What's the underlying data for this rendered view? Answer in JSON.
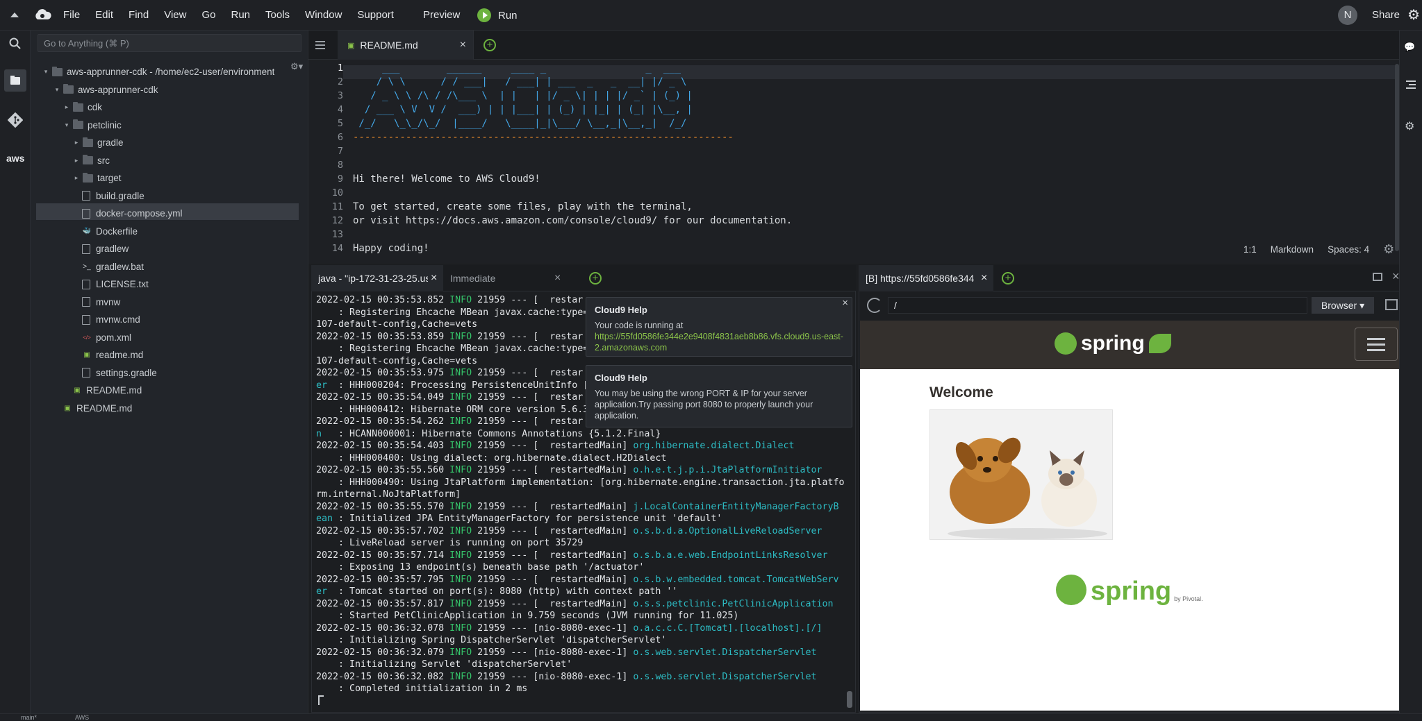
{
  "menubar": {
    "items": [
      "File",
      "Edit",
      "Find",
      "View",
      "Go",
      "Run",
      "Tools",
      "Window",
      "Support"
    ],
    "preview_label": "Preview",
    "run_label": "Run",
    "avatar_letter": "N",
    "share_label": "Share"
  },
  "sidebar": {
    "goto_placeholder": "Go to Anything (⌘ P)",
    "tree": [
      {
        "label": "aws-apprunner-cdk - /home/ec2-user/environment",
        "type": "root"
      },
      {
        "label": "aws-apprunner-cdk",
        "type": "folder-open"
      },
      {
        "label": "cdk",
        "type": "folder-closed"
      },
      {
        "label": "petclinic",
        "type": "folder-open"
      },
      {
        "label": "gradle",
        "type": "folder-closed"
      },
      {
        "label": "src",
        "type": "folder-closed"
      },
      {
        "label": "target",
        "type": "folder-closed"
      },
      {
        "label": "build.gradle",
        "type": "file"
      },
      {
        "label": "docker-compose.yml",
        "type": "file",
        "selected": true
      },
      {
        "label": "Dockerfile",
        "type": "docker"
      },
      {
        "label": "gradlew",
        "type": "file"
      },
      {
        "label": "gradlew.bat",
        "type": "terminal-file"
      },
      {
        "label": "LICENSE.txt",
        "type": "file"
      },
      {
        "label": "mvnw",
        "type": "file"
      },
      {
        "label": "mvnw.cmd",
        "type": "file"
      },
      {
        "label": "pom.xml",
        "type": "xml-file"
      },
      {
        "label": "readme.md",
        "type": "md-file"
      },
      {
        "label": "settings.gradle",
        "type": "file"
      },
      {
        "label": "README.md",
        "type": "md-file"
      },
      {
        "label": "README.md",
        "type": "md-file"
      }
    ]
  },
  "editor": {
    "tab_label": "README.md",
    "line_numbers": [
      "1",
      "2",
      "3",
      "4",
      "5",
      "6",
      "7",
      "8",
      "9",
      "10",
      "11",
      "12",
      "13",
      "14"
    ],
    "lines": [
      "     ___        ______     ____ _                 _  ___",
      "    / \\ \\      / / ___|   / ___| | ___  _   _  __| |/ _ \\",
      "   / _ \\ \\ /\\ / /\\___ \\  | |   | |/ _ \\| | | |/ _` | (_) |",
      "  / ___ \\ V  V /  ___) | | |___| | (_) | |_| | (_| |\\__, |",
      " /_/   \\_\\_/\\_/  |____/   \\____|_|\\___/ \\__,_|\\__,_|  /_/",
      "-----------------------------------------------------------------",
      "",
      "",
      "Hi there! Welcome to AWS Cloud9!",
      "",
      "To get started, create some files, play with the terminal,",
      "or visit https://docs.aws.amazon.com/console/cloud9/ for our documentation.",
      "",
      "Happy coding!"
    ],
    "status": {
      "position": "1:1",
      "mode": "Markdown",
      "spaces": "Spaces: 4"
    }
  },
  "terminal": {
    "tab_label": "java - \"ip-172-31-23-25.us",
    "immediate_label": "Immediate",
    "log": [
      {
        "ts": "2022-02-15 00:35:53.852",
        "lvl": "INFO",
        "rest": " 21959 --- [  restar",
        "cls": ""
      },
      {
        "msg": "    : Registering Ehcache MBean javax.cache:type="
      },
      {
        "msg": "107-default-config,Cache=vets"
      },
      {
        "ts": "2022-02-15 00:35:53.859",
        "lvl": "INFO",
        "rest": " 21959 --- [  restar",
        "cls": ""
      },
      {
        "msg": "    : Registering Ehcache MBean javax.cache:type="
      },
      {
        "msg": "107-default-config,Cache=vets"
      },
      {
        "ts": "2022-02-15 00:35:53.975",
        "lvl": "INFO",
        "rest": " 21959 --- [  restar",
        "cls": ""
      },
      {
        "msg": "er  : HHH000204: Processing PersistenceUnitInfo ["
      },
      {
        "ts": "2022-02-15 00:35:54.049",
        "lvl": "INFO",
        "rest": " 21959 --- [  restar",
        "cls": ""
      },
      {
        "msg": "    : HHH000412: Hibernate ORM core version 5.6.3"
      },
      {
        "ts": "2022-02-15 00:35:54.262",
        "lvl": "INFO",
        "rest": " 21959 --- [  restar",
        "cls": ""
      },
      {
        "msg": "n   : HCANN000001: Hibernate Commons Annotations {5.1.2.Final}"
      },
      {
        "ts": "2022-02-15 00:35:54.403",
        "lvl": "INFO",
        "rest": " 21959 --- [  restartedMain] ",
        "cls": "org.hibernate.dialect.Dialect"
      },
      {
        "msg": "    : HHH000400: Using dialect: org.hibernate.dialect.H2Dialect"
      },
      {
        "ts": "2022-02-15 00:35:55.560",
        "lvl": "INFO",
        "rest": " 21959 --- [  restartedMain] ",
        "cls": "o.h.e.t.j.p.i.JtaPlatformInitiator"
      },
      {
        "msg": "    : HHH000490: Using JtaPlatform implementation: [org.hibernate.engine.transaction.jta.platfo"
      },
      {
        "msg": "rm.internal.NoJtaPlatform]"
      },
      {
        "ts": "2022-02-15 00:35:55.570",
        "lvl": "INFO",
        "rest": " 21959 --- [  restartedMain] ",
        "cls": "j.LocalContainerEntityManagerFactoryB"
      },
      {
        "msg": "ean : Initialized JPA EntityManagerFactory for persistence unit 'default'"
      },
      {
        "ts": "2022-02-15 00:35:57.702",
        "lvl": "INFO",
        "rest": " 21959 --- [  restartedMain] ",
        "cls": "o.s.b.d.a.OptionalLiveReloadServer"
      },
      {
        "msg": "    : LiveReload server is running on port 35729"
      },
      {
        "ts": "2022-02-15 00:35:57.714",
        "lvl": "INFO",
        "rest": " 21959 --- [  restartedMain] ",
        "cls": "o.s.b.a.e.web.EndpointLinksResolver"
      },
      {
        "msg": "    : Exposing 13 endpoint(s) beneath base path '/actuator'"
      },
      {
        "ts": "2022-02-15 00:35:57.795",
        "lvl": "INFO",
        "rest": " 21959 --- [  restartedMain] ",
        "cls": "o.s.b.w.embedded.tomcat.TomcatWebServ"
      },
      {
        "msg": "er  : Tomcat started on port(s): 8080 (http) with context path ''"
      },
      {
        "ts": "2022-02-15 00:35:57.817",
        "lvl": "INFO",
        "rest": " 21959 --- [  restartedMain] ",
        "cls": "o.s.s.petclinic.PetClinicApplication"
      },
      {
        "msg": "    : Started PetClinicApplication in 9.759 seconds (JVM running for 11.025)"
      },
      {
        "ts": "2022-02-15 00:36:32.078",
        "lvl": "INFO",
        "rest": " 21959 --- [nio-8080-exec-1] ",
        "cls": "o.a.c.c.C.[Tomcat].[localhost].[/]"
      },
      {
        "msg": "    : Initializing Spring DispatcherServlet 'dispatcherServlet'"
      },
      {
        "ts": "2022-02-15 00:36:32.079",
        "lvl": "INFO",
        "rest": " 21959 --- [nio-8080-exec-1] ",
        "cls": "o.s.web.servlet.DispatcherServlet"
      },
      {
        "msg": "    : Initializing Servlet 'dispatcherServlet'"
      },
      {
        "ts": "2022-02-15 00:36:32.082",
        "lvl": "INFO",
        "rest": " 21959 --- [nio-8080-exec-1] ",
        "cls": "o.s.web.servlet.DispatcherServlet"
      },
      {
        "msg": "    : Completed initialization in 2 ms"
      }
    ]
  },
  "help": {
    "popup1": {
      "title": "Cloud9 Help",
      "text": "Your code is running at",
      "link": "https://55fd0586fe344e2e9408f4831aeb8b86.vfs.cloud9.us-east-2.amazonaws.com"
    },
    "popup2": {
      "title": "Cloud9 Help",
      "text": "You may be using the wrong PORT & IP for your server application.Try passing port 8080 to properly launch your application."
    }
  },
  "browser": {
    "tab_label": "[B] https://55fd0586fe344",
    "url": "/",
    "browser_button": "Browser",
    "page": {
      "logo_text": "spring",
      "welcome": "Welcome",
      "footer_logo_text": "spring",
      "footer_by": "by Pivotal."
    }
  },
  "bottombar": {
    "branch": "main*",
    "aws": "AWS"
  },
  "colors": {
    "accent_green": "#6db33f",
    "log_info": "#35c46a",
    "log_class": "#2dbcc4",
    "ascii_blue": "#43a6e6",
    "dash_orange": "#f08d2b"
  }
}
